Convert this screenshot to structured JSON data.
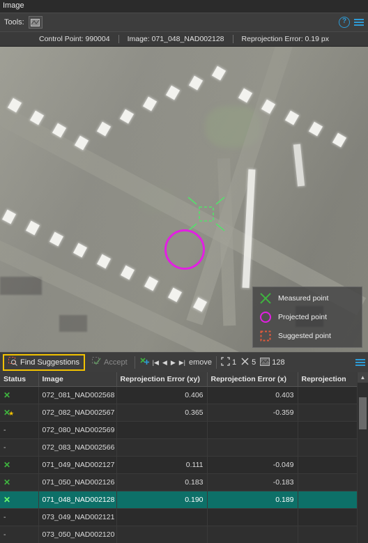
{
  "window": {
    "title": "Image"
  },
  "toolbar": {
    "tools_label": "Tools:",
    "tool_icon": "measure-tool-icon",
    "help_icon": "help-icon",
    "options_icon": "list-options-icon"
  },
  "info": {
    "control_point": "Control Point: 990004",
    "image": "Image: 071_048_NAD002128",
    "reprojection_error": "Reprojection Error: 0.19 px"
  },
  "legend": {
    "items": [
      {
        "icon": "measured-point-icon",
        "label": "Measured point"
      },
      {
        "icon": "projected-point-icon",
        "label": "Projected point"
      },
      {
        "icon": "suggested-point-icon",
        "label": "Suggested point"
      }
    ]
  },
  "actions": {
    "find_suggestions": "Find Suggestions",
    "accept": "Accept",
    "remove": "emove",
    "nav_first": "|◀",
    "nav_prev": "◀",
    "nav_next": "▶",
    "nav_last": "▶|",
    "count_points": "1",
    "count_measured": "5",
    "count_images": "128",
    "accent_yellow": "#f2c200",
    "accent_blue": "#2e9bd6",
    "selection_green": "#0d7068"
  },
  "table": {
    "columns": [
      "Status",
      "Image",
      "Reprojection Error (xy)",
      "Reprojection Error (x)",
      "Reprojection"
    ],
    "rows": [
      {
        "status": "x",
        "image": "072_081_NAD002568",
        "xy": "0.406",
        "x": "0.403",
        "extra": ""
      },
      {
        "status": "x-star",
        "image": "072_082_NAD002567",
        "xy": "0.365",
        "x": "-0.359",
        "extra": ""
      },
      {
        "status": "-",
        "image": "072_080_NAD002569",
        "xy": "",
        "x": "",
        "extra": ""
      },
      {
        "status": "-",
        "image": "072_083_NAD002566",
        "xy": "",
        "x": "",
        "extra": ""
      },
      {
        "status": "x",
        "image": "071_049_NAD002127",
        "xy": "0.111",
        "x": "-0.049",
        "extra": ""
      },
      {
        "status": "x",
        "image": "071_050_NAD002126",
        "xy": "0.183",
        "x": "-0.183",
        "extra": ""
      },
      {
        "status": "x",
        "image": "071_048_NAD002128",
        "xy": "0.190",
        "x": "0.189",
        "extra": "",
        "selected": true
      },
      {
        "status": "-",
        "image": "073_049_NAD002121",
        "xy": "",
        "x": "",
        "extra": ""
      },
      {
        "status": "-",
        "image": "073_050_NAD002120",
        "xy": "",
        "x": "",
        "extra": ""
      }
    ]
  }
}
